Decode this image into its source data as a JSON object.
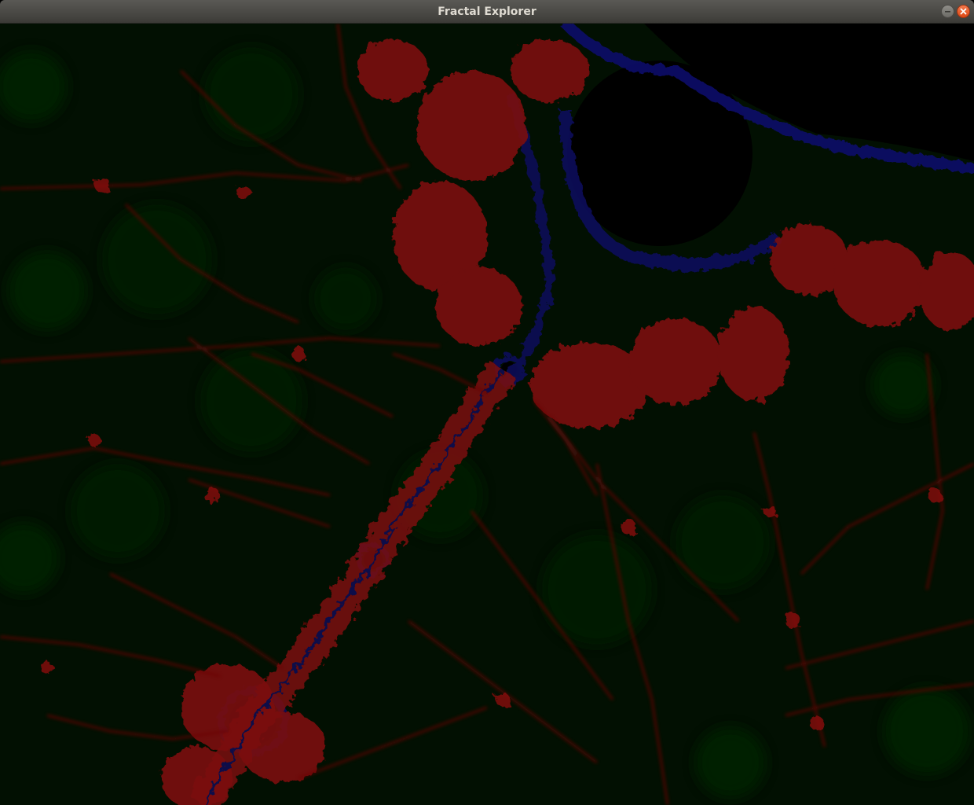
{
  "window": {
    "title": "Fractal Explorer",
    "minimize_icon": "minimize-icon",
    "close_icon": "close-icon"
  },
  "render": {
    "background_color": "#020c02",
    "set_interior_color": "#000000",
    "filament_color": "#7a0808",
    "boundary_color": "#0a0a5a",
    "dark_cloud_color": "#031003"
  }
}
